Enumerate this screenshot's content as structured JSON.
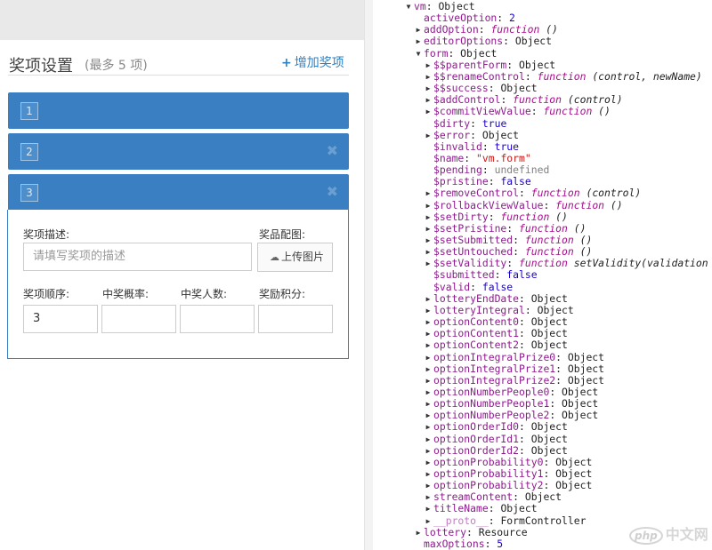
{
  "left": {
    "title": "奖项设置",
    "subtitle": "(最多 5 项)",
    "add_label": "增加奖项",
    "add_icon": "plus-icon",
    "options": [
      {
        "num": "1",
        "closable": false
      },
      {
        "num": "2",
        "closable": true
      },
      {
        "num": "3",
        "closable": true
      }
    ],
    "close_glyph": "✖",
    "form": {
      "desc_label": "奖项描述:",
      "desc_placeholder": "请填写奖项的描述",
      "image_label": "奖品配图:",
      "upload_label": "上传图片",
      "upload_icon": "cloud-upload-icon",
      "order_label": "奖项顺序:",
      "order_value": "3",
      "prob_label": "中奖概率:",
      "people_label": "中奖人数:",
      "points_label": "奖励积分:"
    }
  },
  "tree": {
    "rows": [
      {
        "tri": "down",
        "indent": 0,
        "key": "vm",
        "sep": ": ",
        "val": "Object",
        "vtype": "p"
      },
      {
        "tri": "",
        "indent": 1,
        "key": "activeOption",
        "sep": ": ",
        "val": "2",
        "vtype": "num"
      },
      {
        "tri": "right",
        "indent": 1,
        "key": "addOption",
        "sep": ": ",
        "val": "function",
        "vtype": "fn",
        "args": " ()"
      },
      {
        "tri": "right",
        "indent": 1,
        "key": "editorOptions",
        "sep": ": ",
        "val": "Object",
        "vtype": "p"
      },
      {
        "tri": "down",
        "indent": 1,
        "key": "form",
        "sep": ": ",
        "val": "Object",
        "vtype": "p"
      },
      {
        "tri": "right",
        "indent": 2,
        "key": "$$parentForm",
        "sep": ": ",
        "val": "Object",
        "vtype": "p"
      },
      {
        "tri": "right",
        "indent": 2,
        "key": "$$renameControl",
        "sep": ": ",
        "val": "function",
        "vtype": "fn",
        "args": " (control, newName)"
      },
      {
        "tri": "right",
        "indent": 2,
        "key": "$$success",
        "sep": ": ",
        "val": "Object",
        "vtype": "p"
      },
      {
        "tri": "right",
        "indent": 2,
        "key": "$addControl",
        "sep": ": ",
        "val": "function",
        "vtype": "fn",
        "args": " (control)"
      },
      {
        "tri": "right",
        "indent": 2,
        "key": "$commitViewValue",
        "sep": ": ",
        "val": "function",
        "vtype": "fn",
        "args": " ()"
      },
      {
        "tri": "",
        "indent": 2,
        "key": "$dirty",
        "sep": ": ",
        "val": "true",
        "vtype": "bool"
      },
      {
        "tri": "right",
        "indent": 2,
        "key": "$error",
        "sep": ": ",
        "val": "Object",
        "vtype": "p"
      },
      {
        "tri": "",
        "indent": 2,
        "key": "$invalid",
        "sep": ": ",
        "val": "true",
        "vtype": "bool"
      },
      {
        "tri": "",
        "indent": 2,
        "key": "$name",
        "sep": ": ",
        "val": "\"vm.form\"",
        "vtype": "str"
      },
      {
        "tri": "",
        "indent": 2,
        "key": "$pending",
        "sep": ": ",
        "val": "undefined",
        "vtype": "undef"
      },
      {
        "tri": "",
        "indent": 2,
        "key": "$pristine",
        "sep": ": ",
        "val": "false",
        "vtype": "bool"
      },
      {
        "tri": "right",
        "indent": 2,
        "key": "$removeControl",
        "sep": ": ",
        "val": "function",
        "vtype": "fn",
        "args": " (control)"
      },
      {
        "tri": "right",
        "indent": 2,
        "key": "$rollbackViewValue",
        "sep": ": ",
        "val": "function",
        "vtype": "fn",
        "args": " ()"
      },
      {
        "tri": "right",
        "indent": 2,
        "key": "$setDirty",
        "sep": ": ",
        "val": "function",
        "vtype": "fn",
        "args": " ()"
      },
      {
        "tri": "right",
        "indent": 2,
        "key": "$setPristine",
        "sep": ": ",
        "val": "function",
        "vtype": "fn",
        "args": " ()"
      },
      {
        "tri": "right",
        "indent": 2,
        "key": "$setSubmitted",
        "sep": ": ",
        "val": "function",
        "vtype": "fn",
        "args": " ()"
      },
      {
        "tri": "right",
        "indent": 2,
        "key": "$setUntouched",
        "sep": ": ",
        "val": "function",
        "vtype": "fn",
        "args": " ()"
      },
      {
        "tri": "right",
        "indent": 2,
        "key": "$setValidity",
        "sep": ": ",
        "val": "function",
        "vtype": "fn",
        "args": " setValidity(validation"
      },
      {
        "tri": "",
        "indent": 2,
        "key": "$submitted",
        "sep": ": ",
        "val": "false",
        "vtype": "bool"
      },
      {
        "tri": "",
        "indent": 2,
        "key": "$valid",
        "sep": ": ",
        "val": "false",
        "vtype": "bool"
      },
      {
        "tri": "right",
        "indent": 2,
        "key": "lotteryEndDate",
        "sep": ": ",
        "val": "Object",
        "vtype": "p"
      },
      {
        "tri": "right",
        "indent": 2,
        "key": "lotteryIntegral",
        "sep": ": ",
        "val": "Object",
        "vtype": "p"
      },
      {
        "tri": "right",
        "indent": 2,
        "key": "optionContent0",
        "sep": ": ",
        "val": "Object",
        "vtype": "p"
      },
      {
        "tri": "right",
        "indent": 2,
        "key": "optionContent1",
        "sep": ": ",
        "val": "Object",
        "vtype": "p"
      },
      {
        "tri": "right",
        "indent": 2,
        "key": "optionContent2",
        "sep": ": ",
        "val": "Object",
        "vtype": "p"
      },
      {
        "tri": "right",
        "indent": 2,
        "key": "optionIntegralPrize0",
        "sep": ": ",
        "val": "Object",
        "vtype": "p"
      },
      {
        "tri": "right",
        "indent": 2,
        "key": "optionIntegralPrize1",
        "sep": ": ",
        "val": "Object",
        "vtype": "p"
      },
      {
        "tri": "right",
        "indent": 2,
        "key": "optionIntegralPrize2",
        "sep": ": ",
        "val": "Object",
        "vtype": "p"
      },
      {
        "tri": "right",
        "indent": 2,
        "key": "optionNumberPeople0",
        "sep": ": ",
        "val": "Object",
        "vtype": "p"
      },
      {
        "tri": "right",
        "indent": 2,
        "key": "optionNumberPeople1",
        "sep": ": ",
        "val": "Object",
        "vtype": "p"
      },
      {
        "tri": "right",
        "indent": 2,
        "key": "optionNumberPeople2",
        "sep": ": ",
        "val": "Object",
        "vtype": "p"
      },
      {
        "tri": "right",
        "indent": 2,
        "key": "optionOrderId0",
        "sep": ": ",
        "val": "Object",
        "vtype": "p"
      },
      {
        "tri": "right",
        "indent": 2,
        "key": "optionOrderId1",
        "sep": ": ",
        "val": "Object",
        "vtype": "p"
      },
      {
        "tri": "right",
        "indent": 2,
        "key": "optionOrderId2",
        "sep": ": ",
        "val": "Object",
        "vtype": "p"
      },
      {
        "tri": "right",
        "indent": 2,
        "key": "optionProbability0",
        "sep": ": ",
        "val": "Object",
        "vtype": "p"
      },
      {
        "tri": "right",
        "indent": 2,
        "key": "optionProbability1",
        "sep": ": ",
        "val": "Object",
        "vtype": "p"
      },
      {
        "tri": "right",
        "indent": 2,
        "key": "optionProbability2",
        "sep": ": ",
        "val": "Object",
        "vtype": "p"
      },
      {
        "tri": "right",
        "indent": 2,
        "key": "streamContent",
        "sep": ": ",
        "val": "Object",
        "vtype": "p"
      },
      {
        "tri": "right",
        "indent": 2,
        "key": "titleName",
        "sep": ": ",
        "val": "Object",
        "vtype": "p"
      },
      {
        "tri": "right",
        "indent": 2,
        "key": "__proto__",
        "sep": ": ",
        "val": "FormController",
        "vtype": "p",
        "dim": true
      },
      {
        "tri": "right",
        "indent": 1,
        "key": "lottery",
        "sep": ": ",
        "val": "Resource",
        "vtype": "p"
      },
      {
        "tri": "",
        "indent": 1,
        "key": "maxOptions",
        "sep": ": ",
        "val": "5",
        "vtype": "num"
      }
    ]
  },
  "watermark": {
    "logo": "php",
    "text": "中文网"
  }
}
